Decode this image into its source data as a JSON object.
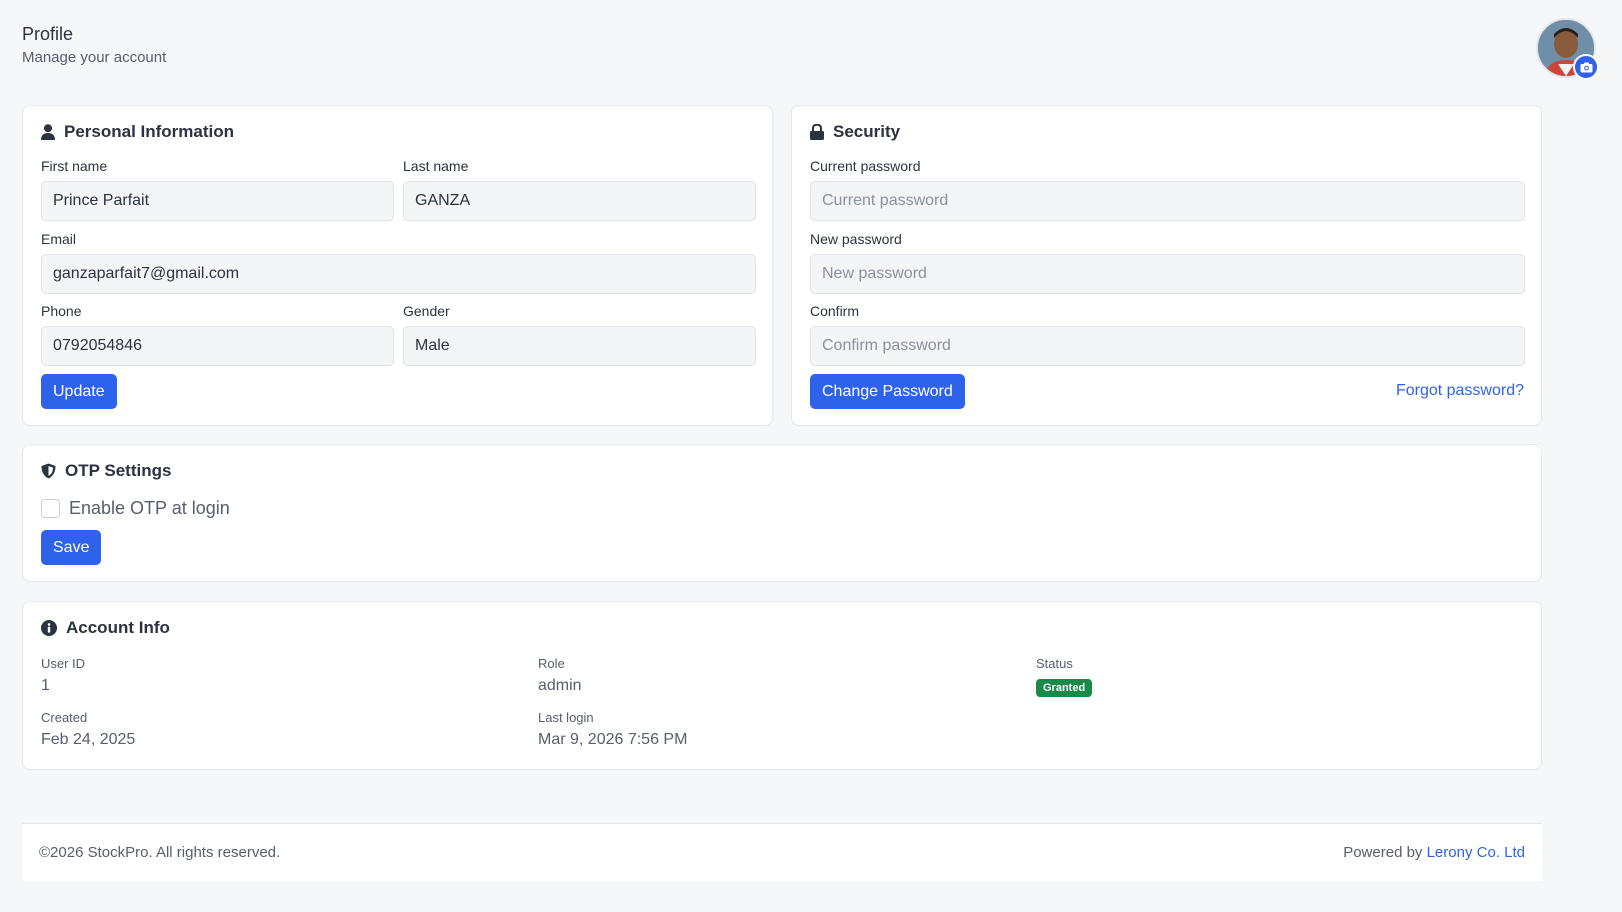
{
  "header": {
    "title": "Profile",
    "subtitle": "Manage your account"
  },
  "personal": {
    "title": "Personal Information",
    "first_name_label": "First name",
    "first_name_value": "Prince Parfait",
    "last_name_label": "Last name",
    "last_name_value": "GANZA",
    "email_label": "Email",
    "email_value": "ganzaparfait7@gmail.com",
    "phone_label": "Phone",
    "phone_value": "0792054846",
    "gender_label": "Gender",
    "gender_value": "Male",
    "update_label": "Update"
  },
  "security": {
    "title": "Security",
    "current_label": "Current password",
    "current_placeholder": "Current password",
    "new_label": "New password",
    "new_placeholder": "New password",
    "confirm_label": "Confirm",
    "confirm_placeholder": "Confirm password",
    "change_label": "Change Password",
    "forgot_label": "Forgot password?"
  },
  "otp": {
    "title": "OTP Settings",
    "enable_label": "Enable OTP at login",
    "enabled": false,
    "save_label": "Save"
  },
  "account": {
    "title": "Account Info",
    "user_id_label": "User ID",
    "user_id_value": "1",
    "role_label": "Role",
    "role_value": "admin",
    "status_label": "Status",
    "status_value": "Granted",
    "created_label": "Created",
    "created_value": "Feb 24, 2025",
    "last_login_label": "Last login",
    "last_login_value": "Mar 9, 2026 7:56 PM"
  },
  "footer": {
    "copyright": "©2026 StockPro. All rights reserved.",
    "powered_prefix": "Powered by",
    "powered_link": "Lerony Co. Ltd"
  },
  "colors": {
    "accent": "#2f62ea",
    "status_granted": "#1a8a4a",
    "background": "#f6f7f9"
  }
}
